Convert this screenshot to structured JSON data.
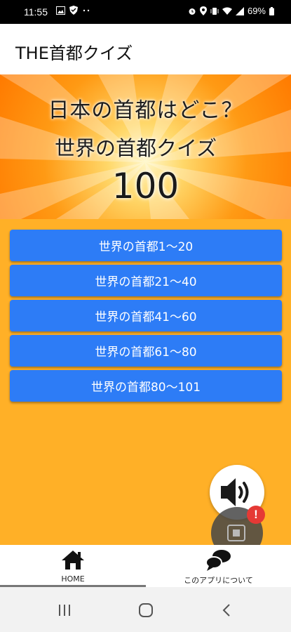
{
  "status_bar": {
    "time": "11:55",
    "battery": "69%",
    "left_icons": [
      "gallery-icon",
      "shield-icon",
      "more-dots-icon"
    ],
    "right_icons": [
      "alarm-icon",
      "location-icon",
      "vibrate-icon",
      "wifi-icon",
      "signal-icon",
      "battery-icon"
    ]
  },
  "app_bar": {
    "title": "THE首都クイズ"
  },
  "banner": {
    "line1": "日本の首都はどこ？",
    "line2": "世界の首都クイズ",
    "line3": "100"
  },
  "menu": {
    "items": [
      {
        "label": "世界の首都1〜20"
      },
      {
        "label": "世界の首都21〜40"
      },
      {
        "label": "世界の首都41〜60"
      },
      {
        "label": "世界の首都61〜80"
      },
      {
        "label": "世界の首都80〜101"
      }
    ],
    "button_color": "#2d7cf6"
  },
  "floating": {
    "sound_icon": "speaker-icon",
    "overlay_icon": "stop-square-icon",
    "alert_badge": "!"
  },
  "bottom_nav": {
    "items": [
      {
        "label": "HOME",
        "icon": "home-icon",
        "selected": true
      },
      {
        "label": "このアプリについて",
        "icon": "chat-bubbles-icon",
        "selected": false
      }
    ]
  },
  "system_nav": {
    "icons": [
      "recent-apps-icon",
      "home-circle-icon",
      "back-icon"
    ]
  },
  "colors": {
    "background": "#ffb027",
    "accent": "#2d7cf6",
    "alert": "#e53935"
  }
}
